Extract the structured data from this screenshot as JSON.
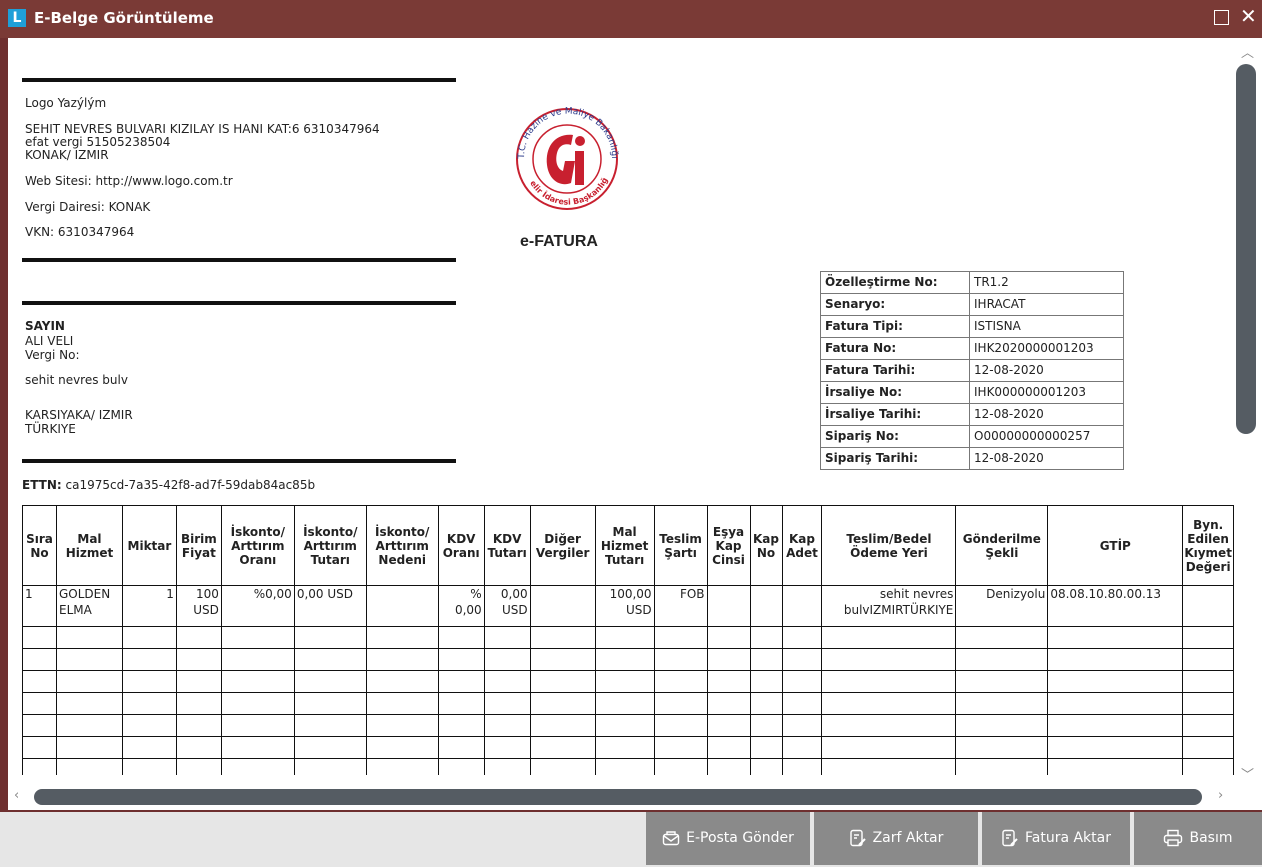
{
  "window": {
    "logo_letter": "L",
    "title": "E-Belge Görüntüleme"
  },
  "seller": {
    "name": "Logo Yazýlým",
    "address1": "SEHIT NEVRES BULVARI KIZILAY IS HANI KAT:6 6310347964",
    "address2": "efat vergi 51505238504",
    "city": "KONAK/ IZMIR",
    "website": "Web Sitesi: http://www.logo.com.tr",
    "tax_office": "Vergi Dairesi: KONAK",
    "vkn": "VKN: 6310347964"
  },
  "buyer": {
    "heading": "SAYIN",
    "name": "ALI VELI",
    "tax_no": "Vergi No:",
    "street": "sehit nevres bulv",
    "city": "KARSIYAKA/ IZMIR",
    "country": "TÜRKIYE"
  },
  "seal": {
    "top_text": "T.C. Hazine ve Maliye Bakanlığı",
    "bottom_text": "Gelir İdaresi Başkanlığı"
  },
  "doc_title": "e-FATURA",
  "invoice_info": [
    {
      "label": "Özelleştirme No:",
      "value": "TR1.2"
    },
    {
      "label": "Senaryo:",
      "value": "IHRACAT"
    },
    {
      "label": "Fatura Tipi:",
      "value": "ISTISNA"
    },
    {
      "label": "Fatura No:",
      "value": "IHK2020000001203"
    },
    {
      "label": "Fatura Tarihi:",
      "value": "12-08-2020"
    },
    {
      "label": "İrsaliye No:",
      "value": "IHK000000001203"
    },
    {
      "label": "İrsaliye Tarihi:",
      "value": "12-08-2020"
    },
    {
      "label": "Sipariş No:",
      "value": "O00000000000257"
    },
    {
      "label": "Sipariş Tarihi:",
      "value": "12-08-2020"
    }
  ],
  "ettn": {
    "label": "ETTN:",
    "value": "ca1975cd-7a35-42f8-ad7f-59dab84ac85b"
  },
  "items_table": {
    "headers": [
      "Sıra No",
      "Mal Hizmet",
      "Miktar",
      "Birim Fiyat",
      "İskonto/ Arttırım Oranı",
      "İskonto/ Arttırım Tutarı",
      "İskonto/ Arttırım Nedeni",
      "KDV Oranı",
      "KDV Tutarı",
      "Diğer Vergiler",
      "Mal Hizmet Tutarı",
      "Teslim Şartı",
      "Eşya Kap Cinsi",
      "Kap No",
      "Kap Adet",
      "Teslim/Bedel Ödeme Yeri",
      "Gönderilme Şekli",
      "GTİP",
      "Byn. Edilen Kıymet Değeri"
    ],
    "rows": [
      [
        "1",
        "GOLDEN ELMA",
        "1",
        "100 USD",
        "%0,00",
        "0,00 USD",
        "",
        "% 0,00",
        "0,00 USD",
        "",
        "100,00 USD",
        "FOB",
        "",
        "",
        "",
        "sehit nevres bulvIZMIRTÜRKIYE",
        "Denizyolu",
        "08.08.10.80.00.13",
        ""
      ]
    ]
  },
  "buttons": {
    "email": "E-Posta Gönder",
    "envelope": "Zarf Aktar",
    "invoice": "Fatura Aktar",
    "print": "Basım"
  }
}
